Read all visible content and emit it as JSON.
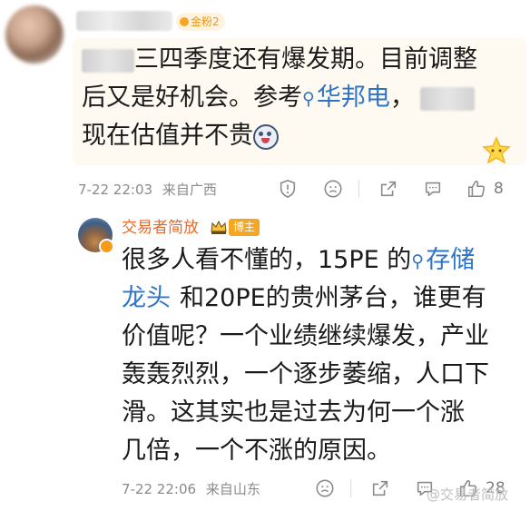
{
  "comment": {
    "fan_badge": "金粉2",
    "text_line1": "三四季度还有爆发期。目前调整",
    "text_line2_a": "后又是好机会。参考",
    "topic": "华邦电",
    "text_line2_b": "，",
    "text_line3": "现在估值并不贵",
    "time": "7-22 22:03",
    "location": "来自广西",
    "like_count": "8"
  },
  "reply": {
    "author": "交易者简放",
    "author_badge": "博主",
    "line1_a": "很多人看不懂的，15PE 的",
    "topic_part1": "存储",
    "topic_part2": "龙头",
    "line2_b": "和20PE的贵州茅台，谁更有",
    "line3": "价值呢？一个业绩继续爆发，产业",
    "line4": "轰轰烈烈，一个逐步萎缩，人口下",
    "line5": "滑。这其实也是过去为何一个涨",
    "line6": "几倍，一个不涨的原因。",
    "time": "7-22 22:06",
    "location": "来自山东",
    "like_count": "28"
  },
  "watermark": "@交易者简放",
  "colors": {
    "topic": "#2d74c9",
    "author": "#e86a2a",
    "badge": "#f5a623"
  }
}
